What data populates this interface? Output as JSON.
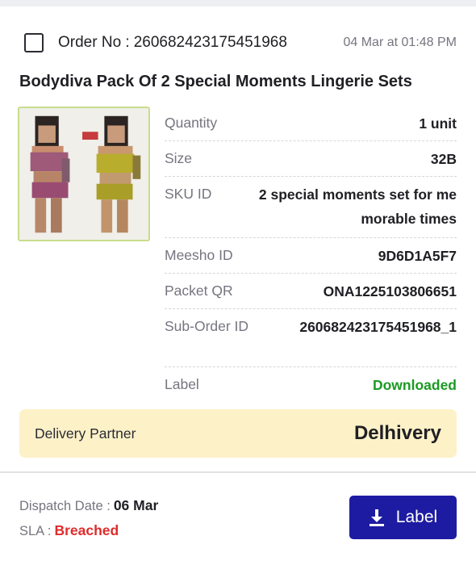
{
  "order": {
    "number_label": "Order No :",
    "number": "260682423175451968",
    "timestamp": "04 Mar at 01:48 PM"
  },
  "product": {
    "title": "Bodydiva Pack Of 2 Special Moments Lingerie Sets",
    "thumbnail_icon": "product-thumbnail-blurred"
  },
  "details": [
    {
      "key": "Quantity",
      "value": "1 unit"
    },
    {
      "key": "Size",
      "value": "32B"
    },
    {
      "key": "SKU ID",
      "value": "2 special moments set for me morable times"
    },
    {
      "key": "Meesho ID",
      "value": "9D6D1A5F7"
    },
    {
      "key": "Packet QR",
      "value": "ONA1225103806651"
    },
    {
      "key": "Sub-Order ID",
      "value": "260682423175451968_1"
    },
    {
      "key": "Label",
      "value": "Downloaded"
    }
  ],
  "delivery": {
    "label": "Delivery Partner",
    "partner": "Delhivery"
  },
  "footer": {
    "dispatch_label": "Dispatch Date :",
    "dispatch_value": "06 Mar",
    "sla_label": "SLA :",
    "sla_value": "Breached"
  },
  "action": {
    "label_button": "Label",
    "icon": "download-icon"
  },
  "colors": {
    "accent": "#1d1ba1",
    "success": "#1a9a22",
    "danger": "#e02b2b",
    "delivery_bg": "#fdf1c8"
  }
}
